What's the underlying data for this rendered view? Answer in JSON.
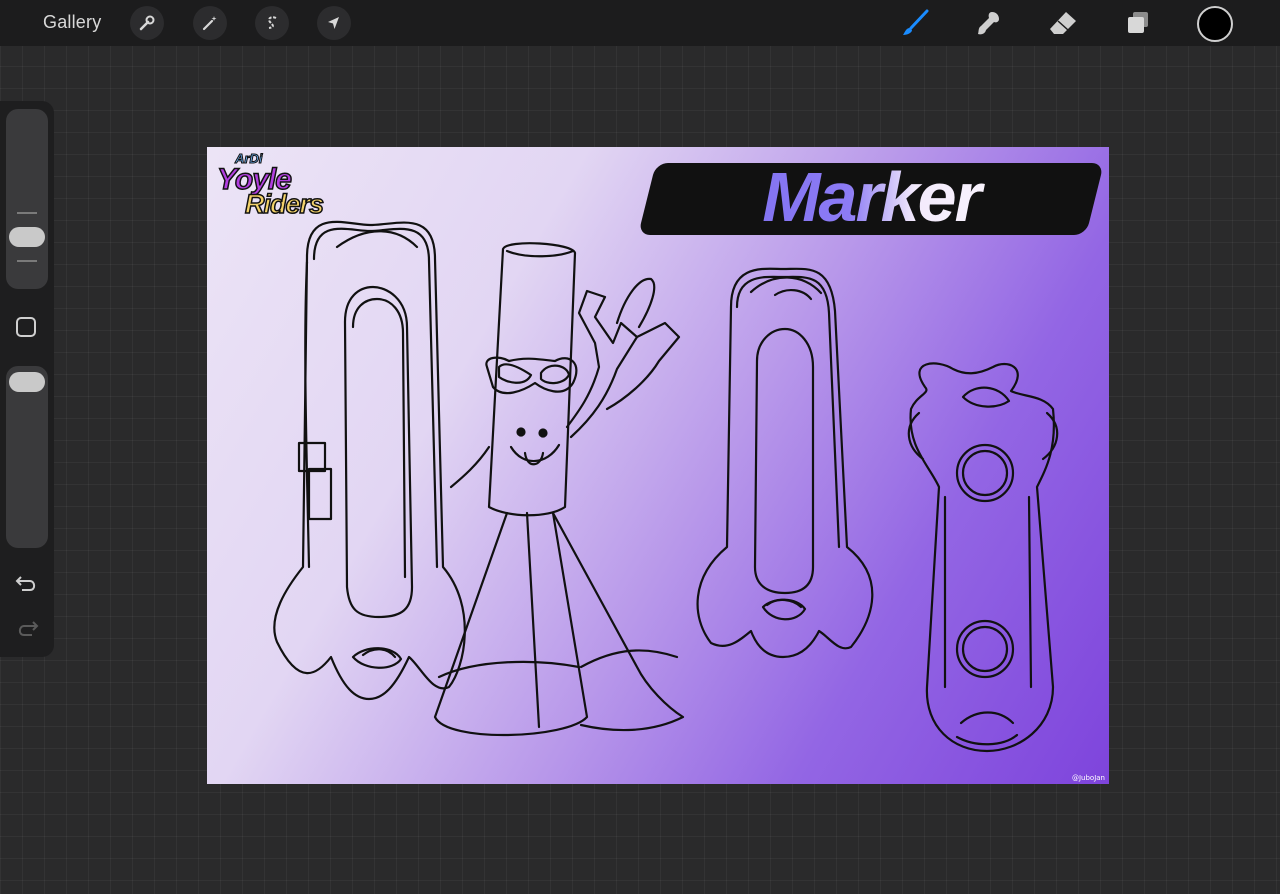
{
  "toolbar": {
    "gallery_label": "Gallery",
    "left_tools": [
      {
        "name": "actions",
        "icon": "wrench-icon"
      },
      {
        "name": "adjustments",
        "icon": "magic-wand-icon"
      },
      {
        "name": "selection",
        "icon": "selection-s-icon"
      },
      {
        "name": "transform",
        "icon": "arrow-cursor-icon"
      }
    ],
    "right_tools": [
      {
        "name": "brush",
        "icon": "brush-icon",
        "active": true,
        "color": "#1a8cff"
      },
      {
        "name": "smudge",
        "icon": "smudge-icon"
      },
      {
        "name": "eraser",
        "icon": "eraser-icon"
      },
      {
        "name": "layers",
        "icon": "layers-icon"
      }
    ],
    "current_color": "#000000"
  },
  "sidebar": {
    "brush_size_level": 0.55,
    "opacity_level": 0.95,
    "modify_button_icon": "square-icon",
    "undo_icon": "undo-icon",
    "redo_icon": "redo-icon"
  },
  "canvas": {
    "logo": {
      "line1": "ArDi",
      "line2": "Yoyle",
      "line3": "Riders"
    },
    "title": "Marker",
    "credit": "@JuboJan",
    "gradient_start": "#ece4f6",
    "gradient_end": "#7e44dc"
  }
}
